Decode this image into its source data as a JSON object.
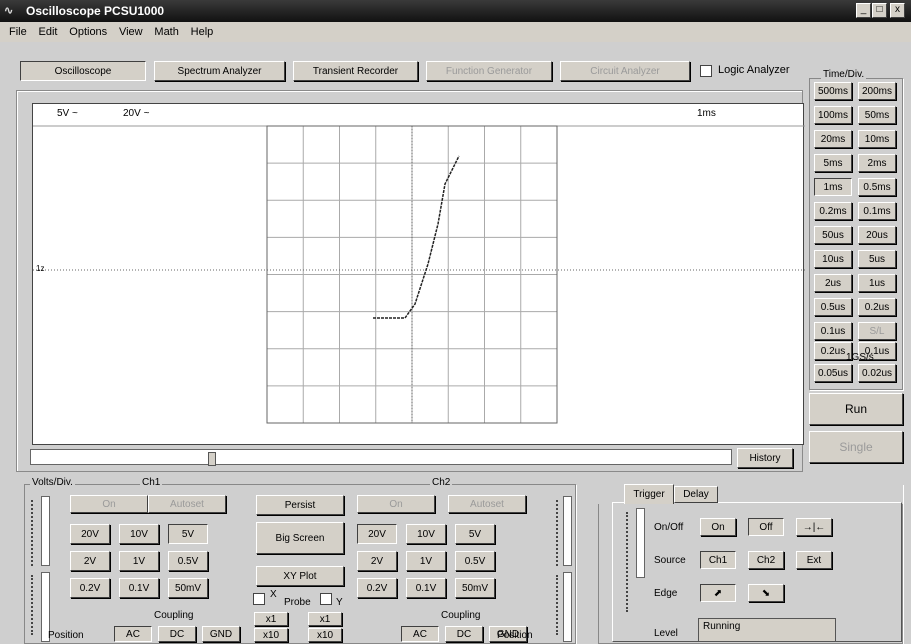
{
  "window": {
    "title": "Oscilloscope PCSU1000",
    "minimize": "_",
    "maximize": "□",
    "close": "x"
  },
  "menu": [
    "File",
    "Edit",
    "Options",
    "View",
    "Math",
    "Help"
  ],
  "mode_buttons": [
    {
      "label": "Oscilloscope",
      "state": "pressed"
    },
    {
      "label": "Spectrum Analyzer",
      "state": "normal"
    },
    {
      "label": "Transient Recorder",
      "state": "normal"
    },
    {
      "label": "Function Generator",
      "state": "disabled"
    },
    {
      "label": "Circuit Analyzer",
      "state": "disabled"
    }
  ],
  "logic_analyzer": {
    "label": "Logic Analyzer",
    "checked": false
  },
  "timediv": {
    "title": "Time/Div.",
    "buttons": [
      [
        "500ms",
        "200ms"
      ],
      [
        "100ms",
        "50ms"
      ],
      [
        "20ms",
        "10ms"
      ],
      [
        "5ms",
        "2ms"
      ],
      [
        "1ms",
        "0.5ms"
      ],
      [
        "0.2ms",
        "0.1ms"
      ],
      [
        "50us",
        "20us"
      ],
      [
        "10us",
        "5us"
      ],
      [
        "2us",
        "1us"
      ],
      [
        "0.5us",
        "0.2us"
      ],
      [
        "0.1us",
        "S/L"
      ]
    ],
    "rate": "1GS/s",
    "buttons2": [
      [
        "0.2us",
        "0.1us"
      ],
      [
        "0.05us",
        "0.02us"
      ]
    ],
    "selected": "1ms"
  },
  "run": "Run",
  "single": "Single",
  "screen": {
    "ch1_scale": "5V ~",
    "ch2_scale": "20V ~",
    "time_scale": "1ms",
    "ch_marker": "1z"
  },
  "history": "History",
  "volts": {
    "title": "Volts/Div.",
    "ch1": "Ch1",
    "ch2": "Ch2"
  },
  "ch1": {
    "on": "On",
    "autoset": "Autoset",
    "row1": [
      "20V",
      "10V",
      "5V"
    ],
    "row2": [
      "2V",
      "1V",
      "0.5V"
    ],
    "row3": [
      "0.2V",
      "0.1V",
      "50mV"
    ],
    "selected": "5V",
    "coupling_title": "Coupling",
    "coupling": [
      "AC",
      "DC",
      "GND"
    ],
    "position": "Position"
  },
  "ch2": {
    "on": "On",
    "autoset": "Autoset",
    "row1": [
      "20V",
      "10V",
      "5V"
    ],
    "row2": [
      "2V",
      "1V",
      "0.5V"
    ],
    "row3": [
      "0.2V",
      "0.1V",
      "50mV"
    ],
    "selected": "20V",
    "coupling_title": "Coupling",
    "coupling": [
      "AC",
      "DC",
      "GND"
    ],
    "position": "Position"
  },
  "center": {
    "persist": "Persist",
    "big_screen": "Big Screen",
    "xy_plot": "XY Plot",
    "probe": "Probe",
    "x_label": "X",
    "y_label": "Y",
    "x1a": "x1",
    "x10a": "x10",
    "x1b": "x1",
    "x10b": "x10"
  },
  "trigger": {
    "tabs": [
      "Trigger",
      "Delay"
    ],
    "onoff": "On/Off",
    "on": "On",
    "off": "Off",
    "arrows": "→|←",
    "source": "Source",
    "ch1": "Ch1",
    "ch2": "Ch2",
    "ext": "Ext",
    "edge": "Edge",
    "level": "Level",
    "status": "Running"
  }
}
